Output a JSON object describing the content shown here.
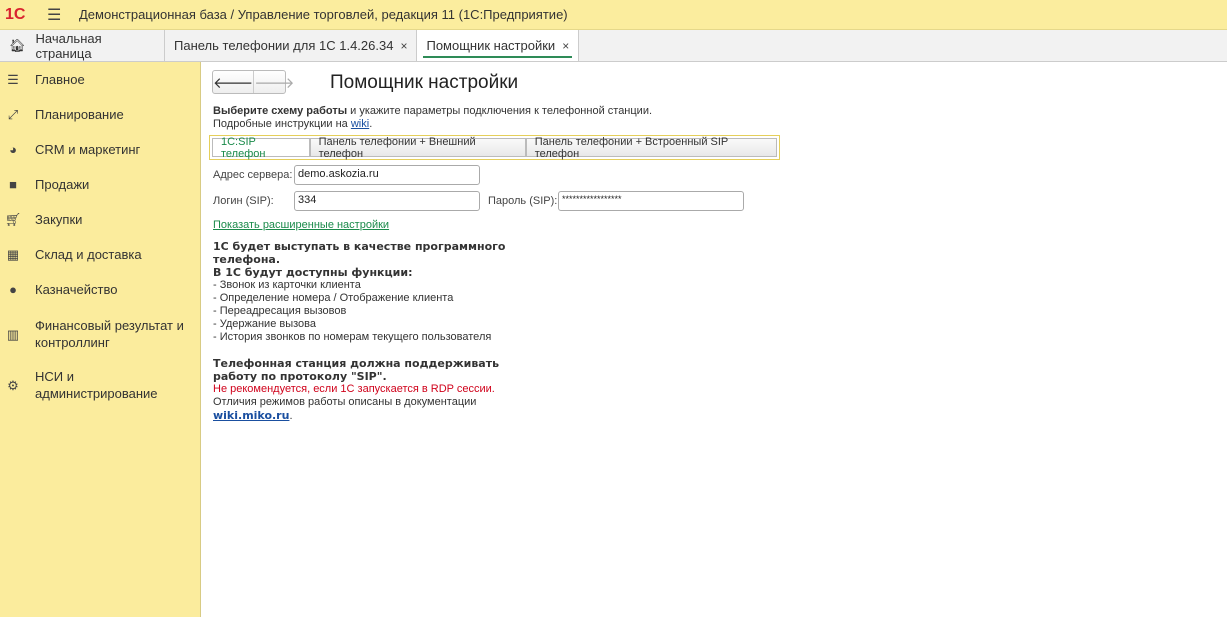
{
  "window": {
    "logo": "1С",
    "title": "Демонстрационная база / Управление торговлей, редакция 11  (1С:Предприятие)"
  },
  "tabs": [
    {
      "label": "Начальная страница"
    },
    {
      "label": "Панель телефонии для 1С 1.4.26.34",
      "close": "×"
    },
    {
      "label": "Помощник настройки",
      "close": "×"
    }
  ],
  "sidebar": {
    "items": [
      {
        "label": "Главное",
        "icon": "menu-icon"
      },
      {
        "label": "Планирование",
        "icon": "planning-icon"
      },
      {
        "label": "CRM и маркетинг",
        "icon": "pie-chart-icon"
      },
      {
        "label": "Продажи",
        "icon": "bag-icon"
      },
      {
        "label": "Закупки",
        "icon": "cart-icon"
      },
      {
        "label": "Склад и доставка",
        "icon": "warehouse-icon"
      },
      {
        "label": "Казначейство",
        "icon": "ruble-icon"
      },
      {
        "label": "Финансовый результат и контроллинг",
        "icon": "bar-chart-icon"
      },
      {
        "label": "НСИ и администрирование",
        "icon": "gear-icon"
      }
    ]
  },
  "main": {
    "back": "🡐",
    "forward": "🡒",
    "title": "Помощник настройки",
    "intro_bold": "Выберите схему работы",
    "intro_rest": " и укажите параметры подключения к телефонной станции.",
    "intro2": "Подробные инструкции на ",
    "wiki": "wiki",
    "dot": ".",
    "modes": [
      "1С:SIP телефон",
      "Панель телефонии + Внешний телефон",
      "Панель телефонии + Встроенный SIP телефон"
    ],
    "server_label": "Адрес сервера:",
    "server_value": "demo.askozia.ru",
    "login_label": "Логин (SIP):",
    "login_value": "334",
    "password_label": "Пароль (SIP):",
    "password_value": "*****************",
    "advanced": "Показать расширенные настройки",
    "info_bold1": "1С будет выступать в качестве программного телефона.",
    "info_bold2": "В 1С будут доступны функции:",
    "features": [
      "- Звонок из карточки клиента",
      "- Определение номера / Отображение клиента",
      "- Переадресация вызовов",
      "- Удержание вызова",
      "- История звонков по номерам текущего пользователя"
    ],
    "info_bold3": "Телефонная станция должна поддерживать работу по протоколу \"SIP\".",
    "warning": "Не рекомендуется, если 1С запускается в RDP сессии.",
    "doc_text": "Отличия режимов работы описаны в документации",
    "doc_link": "wiki.miko.ru"
  }
}
